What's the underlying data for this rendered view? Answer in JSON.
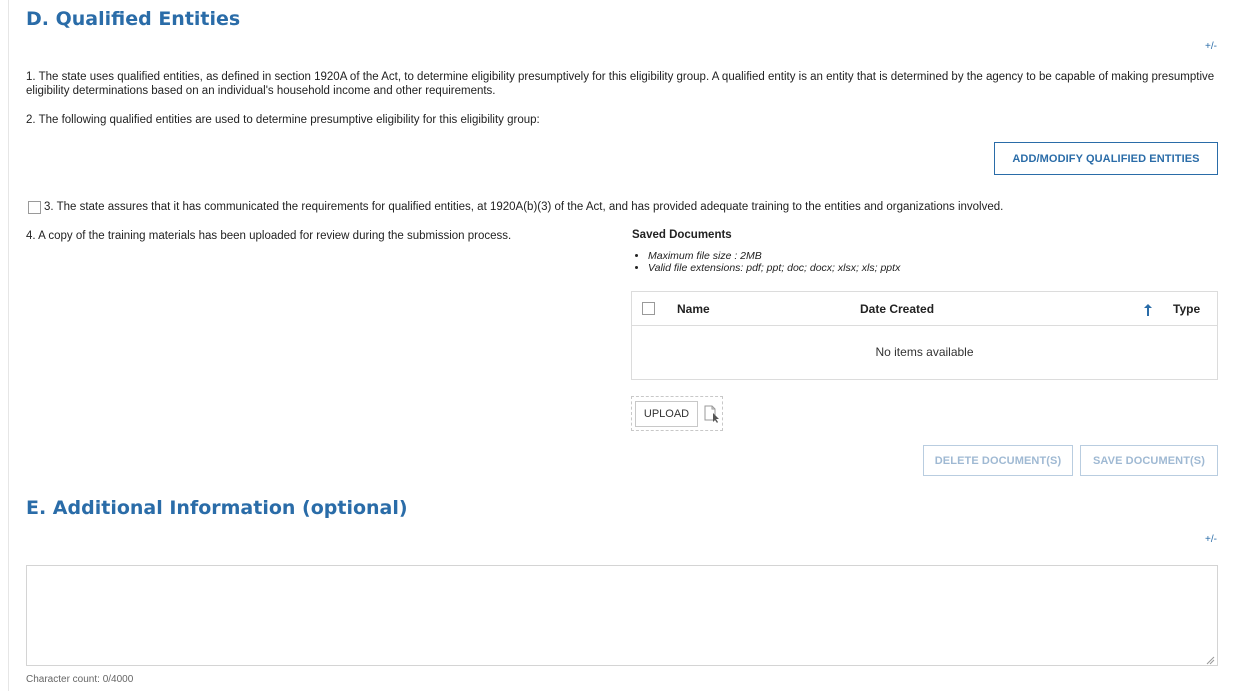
{
  "section_d": {
    "heading": "D. Qualified Entities",
    "toggle": "+/-",
    "item1": "1. The state uses qualified entities, as defined in section 1920A of the Act, to determine eligibility presumptively for this eligibility group.  A qualified entity is an entity that is determined by the agency to be capable of making presumptive eligibility determinations based on an individual's household income and other requirements.",
    "item2": "2. The following qualified entities are used to determine presumptive eligibility for this eligibility group:",
    "add_modify_button": "ADD/MODIFY QUALIFIED ENTITIES",
    "item3": "3. The state assures that it has communicated the requirements for qualified entities, at 1920A(b)(3) of the Act, and has provided adequate training to the entities and organizations involved.",
    "item3_checked": false,
    "item4": "4. A copy of the training materials has been uploaded for review during the submission process."
  },
  "documents": {
    "title": "Saved Documents",
    "notes": [
      "Maximum file size : 2MB",
      "Valid file extensions: pdf; ppt; doc; docx; xlsx; xls; pptx"
    ],
    "columns": {
      "name": "Name",
      "date_created": "Date Created",
      "type": "Type"
    },
    "sort_icon": "arrow-up-icon",
    "empty_text": "No items available",
    "upload_label": "UPLOAD",
    "delete_label": "DELETE DOCUMENT(S)",
    "save_label": "SAVE DOCUMENT(S)"
  },
  "section_e": {
    "heading": "E. Additional Information (optional)",
    "toggle": "+/-",
    "textarea_value": "",
    "char_count": "Character count: 0/4000"
  },
  "colors": {
    "heading": "#2a6ca8",
    "border": "#dcdcdc",
    "disabled": "#9fb9d3"
  }
}
